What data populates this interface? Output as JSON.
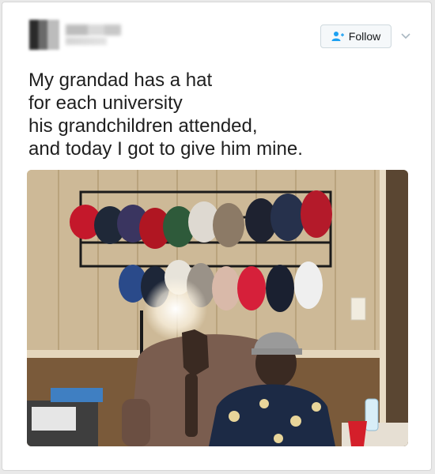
{
  "tweet": {
    "follow_label": "Follow",
    "text": "My grandad has a hat\nfor each university\nhis grandchildren attended,\nand today I got to give him mine.",
    "photo_description_hint": ""
  },
  "icons": {
    "follow": "add-user-icon",
    "more": "chevron-down-icon"
  },
  "colors": {
    "follow_icon": "#1da1f2",
    "text": "#1f1f1f"
  }
}
